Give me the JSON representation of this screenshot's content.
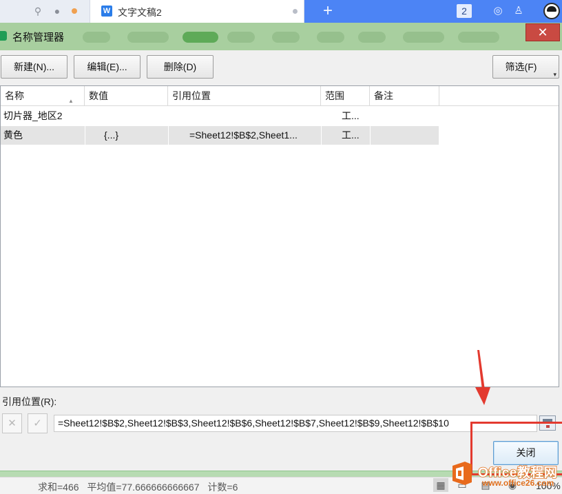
{
  "browser": {
    "tab_title": "文字文稿2",
    "window_count": "2"
  },
  "dialog": {
    "title": "名称管理器",
    "close_glyph": "✕",
    "toolbar": {
      "new_label": "新建(N)...",
      "edit_label": "编辑(E)...",
      "delete_label": "删除(D)",
      "filter_label": "筛选(F)"
    },
    "columns": [
      "名称",
      "数值",
      "引用位置",
      "范围",
      "备注"
    ],
    "rows": [
      {
        "name": "切片器_地区2",
        "value": "",
        "refers_to": "",
        "scope": "工...",
        "comment": ""
      },
      {
        "name": "黄色",
        "value": "{...}",
        "refers_to": "=Sheet12!$B$2,Sheet1...",
        "scope": "工...",
        "comment": ""
      }
    ],
    "refers_to_label": "引用位置(R):",
    "cancel_glyph": "✕",
    "confirm_glyph": "✓",
    "refers_to_value": "=Sheet12!$B$2,Sheet12!$B$3,Sheet12!$B$6,Sheet12!$B$7,Sheet12!$B$9,Sheet12!$B$10",
    "close_label": "关闭"
  },
  "statusbar": {
    "sum": "求和=466",
    "average": "平均值=77.666666666667",
    "count": "计数=6",
    "zoom": "100%"
  },
  "watermark": {
    "title": "Office教程网",
    "url": "www.office26.com"
  },
  "colors": {
    "accent_green": "#1f9d55",
    "close_red": "#c94a42",
    "annotation_red": "#e33a2f",
    "selection_gray": "#e4e4e4",
    "browser_blue": "#4c84f5"
  }
}
